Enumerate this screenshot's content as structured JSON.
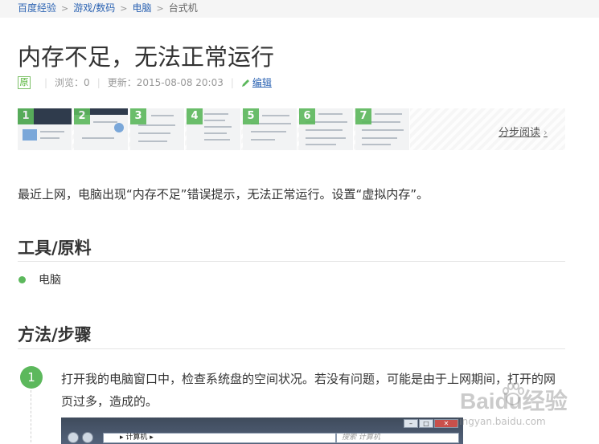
{
  "breadcrumb": {
    "items": [
      "百度经验",
      "游戏/数码",
      "电脑"
    ],
    "current": "台式机"
  },
  "article": {
    "title": "内存不足，无法正常运行",
    "original_badge": "原",
    "views": "浏览：0",
    "updated": "更新：2015-08-08 20:03",
    "edit_label": "编辑"
  },
  "thumbnails": {
    "numbers": [
      "1",
      "2",
      "3",
      "4",
      "5",
      "6",
      "7"
    ],
    "step_reading_label": "分步阅读",
    "chevron": "›"
  },
  "intro": "最近上网，电脑出现“内存不足”错误提示，无法正常运行。设置“虚拟内存”。",
  "tools": {
    "heading": "工具/原料",
    "items": [
      "电脑"
    ]
  },
  "method": {
    "heading": "方法/步骤",
    "steps": [
      {
        "number": "1",
        "text": "打开我的电脑窗口中，检查系统盘的空间状况。若没有问题，可能是由于上网期间，打开的网页过多，造成的。"
      }
    ]
  },
  "step_screenshot": {
    "address": "▸ 计算机 ▸",
    "search_placeholder": "搜索 计算机"
  },
  "watermark": {
    "logo": "Baidu",
    "logo_suffix": "经验",
    "url": "jingyan.baidu.com"
  },
  "colors": {
    "accent_green": "#5cb85c",
    "link_blue": "#2d64b3"
  }
}
